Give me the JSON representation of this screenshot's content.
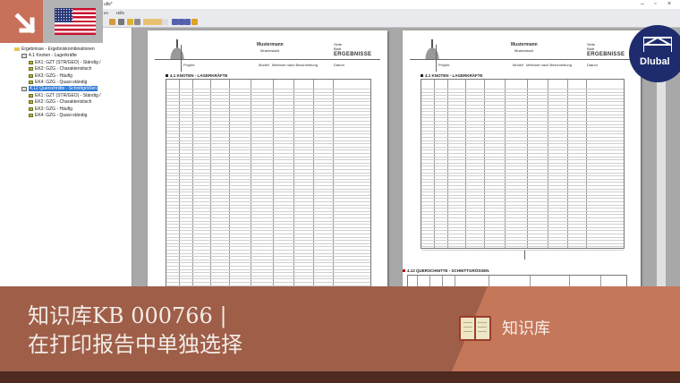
{
  "window": {
    "title": "ults*",
    "menu": [
      "en",
      "Hilfe"
    ]
  },
  "tree": {
    "items": [
      {
        "label": "Ergebnisse - Ergebniskombinationen",
        "level": 1,
        "icon": "folder"
      },
      {
        "label": "4.1 Knoten - Lagerkräfte",
        "level": 2,
        "icon": "table"
      },
      {
        "label": "EK1: GZT (STR/GEO) - Ständig /",
        "level": 3,
        "icon": "combo"
      },
      {
        "label": "EK2: GZG - Charakteristisch",
        "level": 3,
        "icon": "combo"
      },
      {
        "label": "EK3: GZG - Häufig",
        "level": 3,
        "icon": "combo"
      },
      {
        "label": "EK4: GZG - Quasi-ständig",
        "level": 3,
        "icon": "combo"
      },
      {
        "label": "4.12 Querschnitte - Schnittgrößen",
        "level": 2,
        "icon": "table",
        "selected": true
      },
      {
        "label": "EK1: GZT (STR/GEO) - Ständig /",
        "level": 3,
        "icon": "combo"
      },
      {
        "label": "EK2: GZG - Charakteristisch",
        "level": 3,
        "icon": "combo"
      },
      {
        "label": "EK3: GZG - Häufig",
        "level": 3,
        "icon": "combo"
      },
      {
        "label": "EK4: GZG - Quasi-ständig",
        "level": 3,
        "icon": "combo"
      }
    ]
  },
  "report": {
    "company": "Mustermann",
    "city": "Musterstadt",
    "badge": "ERGEBNISSE",
    "labels": {
      "page": "Seite",
      "sheet": "Blatt",
      "project": "Projekt",
      "model": "Modell",
      "date": "Datum"
    },
    "model_value": "Methode nach Beschreibung",
    "section1": "4.1 KNOTEN - LAGERKRÄFTE",
    "section2": "4.12 QUERSCHNITTE - SCHNITTGRÖSSEN"
  },
  "logo": {
    "text": "Dlubal"
  },
  "banner": {
    "line1": "知识库KB 000766 |",
    "line2": "在打印报告中单独选择",
    "tag": "知识库"
  },
  "colors": {
    "accent": "#c8705a",
    "banner": "#9f5e48",
    "banner_right": "#c57759",
    "footer": "#4f2a20",
    "logo": "#1e2c6e"
  }
}
